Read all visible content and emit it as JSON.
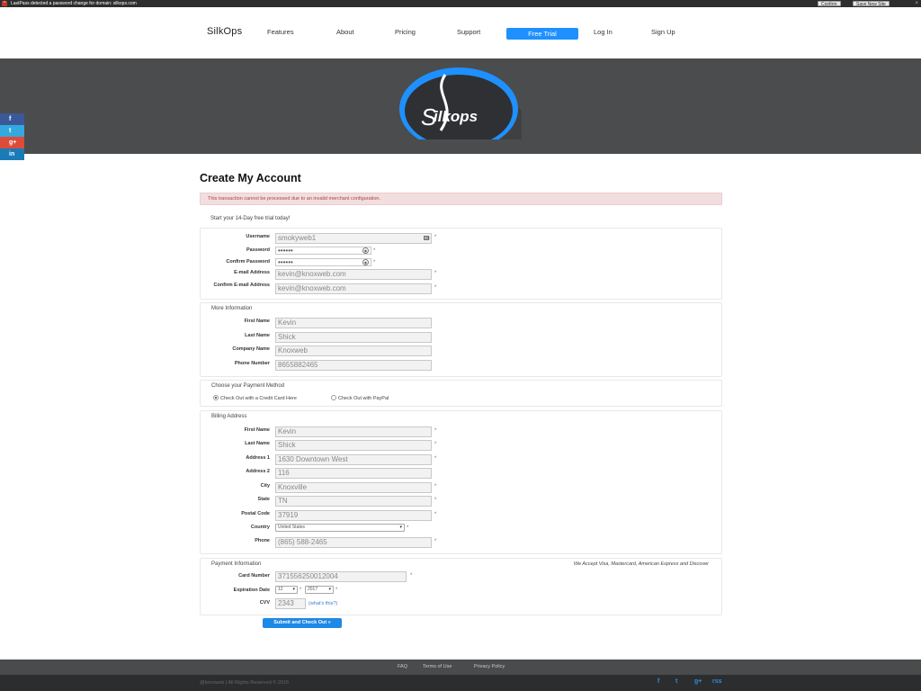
{
  "lastpass": {
    "icon": "asterisk-icon",
    "message": "LastPass detected a password change for domain: silkops.com",
    "confirm_label": "Confirm",
    "save_label": "Save New Site",
    "close": "×"
  },
  "nav": {
    "brand": "SilkOps",
    "items": [
      "Features",
      "About",
      "Pricing",
      "Support"
    ],
    "trial_label": "Free Trial",
    "login_label": "Log In",
    "signup_label": "Sign Up"
  },
  "hero": {
    "logo_text": "ilkops",
    "logo_initial": "S"
  },
  "social": [
    {
      "icon": "facebook-icon",
      "glyph": "f",
      "color": "#3b5998"
    },
    {
      "icon": "twitter-icon",
      "glyph": "t",
      "color": "#33a9e0"
    },
    {
      "icon": "google-plus-icon",
      "glyph": "g+",
      "color": "#dd4b39"
    },
    {
      "icon": "linkedin-icon",
      "glyph": "in",
      "color": "#1a7bb9"
    }
  ],
  "page": {
    "title": "Create My Account",
    "alert": "This transaction cannot be processed due to an invalid merchant configuration.",
    "intro": "Start your 14-Day free trial today!"
  },
  "account": {
    "username_label": "Username",
    "username": "smokyweb1",
    "password_label": "Password",
    "password": "••••••",
    "confirm_password_label": "Confirm Password",
    "confirm_password": "••••••",
    "email_label": "E-mail Address",
    "email": "kevin@knoxweb.com",
    "confirm_email_label": "Confirm E-mail Address",
    "confirm_email": "kevin@knoxweb.com",
    "required_mark": "*"
  },
  "more": {
    "title": "More Information",
    "first_name_label": "First Name",
    "first_name": "Kevin",
    "last_name_label": "Last Name",
    "last_name": "Shick",
    "company_label": "Company Name",
    "company": "Knoxweb",
    "phone_label": "Phone Number",
    "phone": "8655882465"
  },
  "payment_method": {
    "title": "Choose your Payment Method",
    "credit_card": "Check Out with a Credit Card Here",
    "paypal": "Check Out with PayPal"
  },
  "billing": {
    "title": "Billing Address",
    "first_name_label": "First Name",
    "first_name": "Kevin",
    "last_name_label": "Last Name",
    "last_name": "Shick",
    "address1_label": "Address 1",
    "address1": "1630 Downtown West",
    "address2_label": "Address 2",
    "address2": "116",
    "city_label": "City",
    "city": "Knoxville",
    "state_label": "State",
    "state": "TN",
    "postal_label": "Postal Code",
    "postal": "37919",
    "country_label": "Country",
    "country": "United States",
    "phone_label": "Phone",
    "phone": "(865) 588-2465"
  },
  "payment": {
    "title": "Payment Information",
    "note": "We Accept Visa, Mastercard, American Express and Discover",
    "card_label": "Card Number",
    "card": "371556250012004",
    "exp_label": "Expiration Date",
    "exp_month": "12",
    "exp_year": "2017",
    "cvv_label": "CVV",
    "cvv": "2343",
    "cvv_help": "(what's this?)",
    "submit_label": "Submit and Check Out »"
  },
  "footer": {
    "links": [
      "FAQ",
      "Terms of Use",
      "Privacy Policy"
    ],
    "copyright": "@knoxweb | All Rights Reserved © 2015",
    "social": [
      {
        "icon": "facebook-icon",
        "glyph": "f"
      },
      {
        "icon": "twitter-icon",
        "glyph": "t"
      },
      {
        "icon": "google-plus-icon",
        "glyph": "g+"
      },
      {
        "icon": "rss-icon",
        "glyph": "rss"
      }
    ]
  }
}
